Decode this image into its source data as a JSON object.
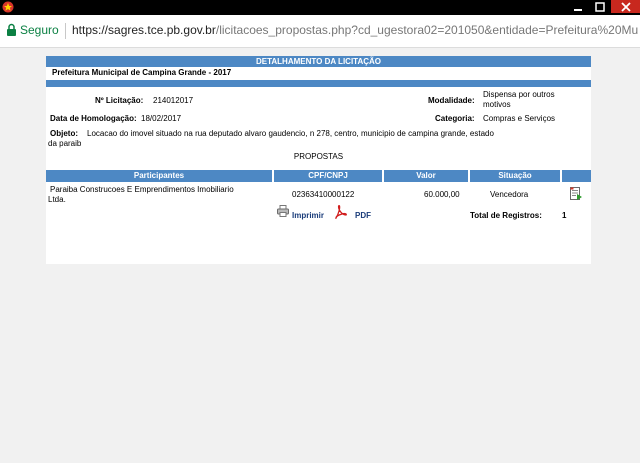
{
  "browser": {
    "secure_label": "Seguro",
    "url_host": "https://sagres.tce.pb.gov.br",
    "url_rest": "/licitacoes_propostas.php?cd_ugestora02=201050&entidade=Prefeitura%20Mun"
  },
  "detail": {
    "header": "DETALHAMENTO DA LICITAÇÃO",
    "entity": "Prefeitura Municipal de Campina Grande - 2017",
    "licitacao_label": "Nº Licitação:",
    "licitacao_value": "214012017",
    "modalidade_label": "Modalidade:",
    "modalidade_value_1": "Dispensa por outros",
    "modalidade_value_2": "motivos",
    "homologacao_label": "Data de Homologação:",
    "homologacao_value": "18/02/2017",
    "categoria_label": "Categoria:",
    "categoria_value": "Compras e Serviços",
    "objeto_label": "Objeto:",
    "objeto_value_1": "Locacao do imovel situado na rua deputado alvaro gaudencio, n 278, centro, municipio de campina grande, estado",
    "objeto_value_2": "da paraib"
  },
  "proposals": {
    "section_title": "PROPOSTAS",
    "columns": [
      "Participantes",
      "CPF/CNPJ",
      "Valor",
      "Situação"
    ],
    "rows": [
      {
        "participant_1": "Paraiba Construcoes E Emprendimentos Imobiliario",
        "participant_2": "Ltda.",
        "cnpj": "02363410000122",
        "valor": "60.000,00",
        "situacao": "Vencedora"
      }
    ],
    "print_label": "Imprimir",
    "pdf_label": "PDF",
    "total_label": "Total de Registros:",
    "total_value": "1"
  }
}
